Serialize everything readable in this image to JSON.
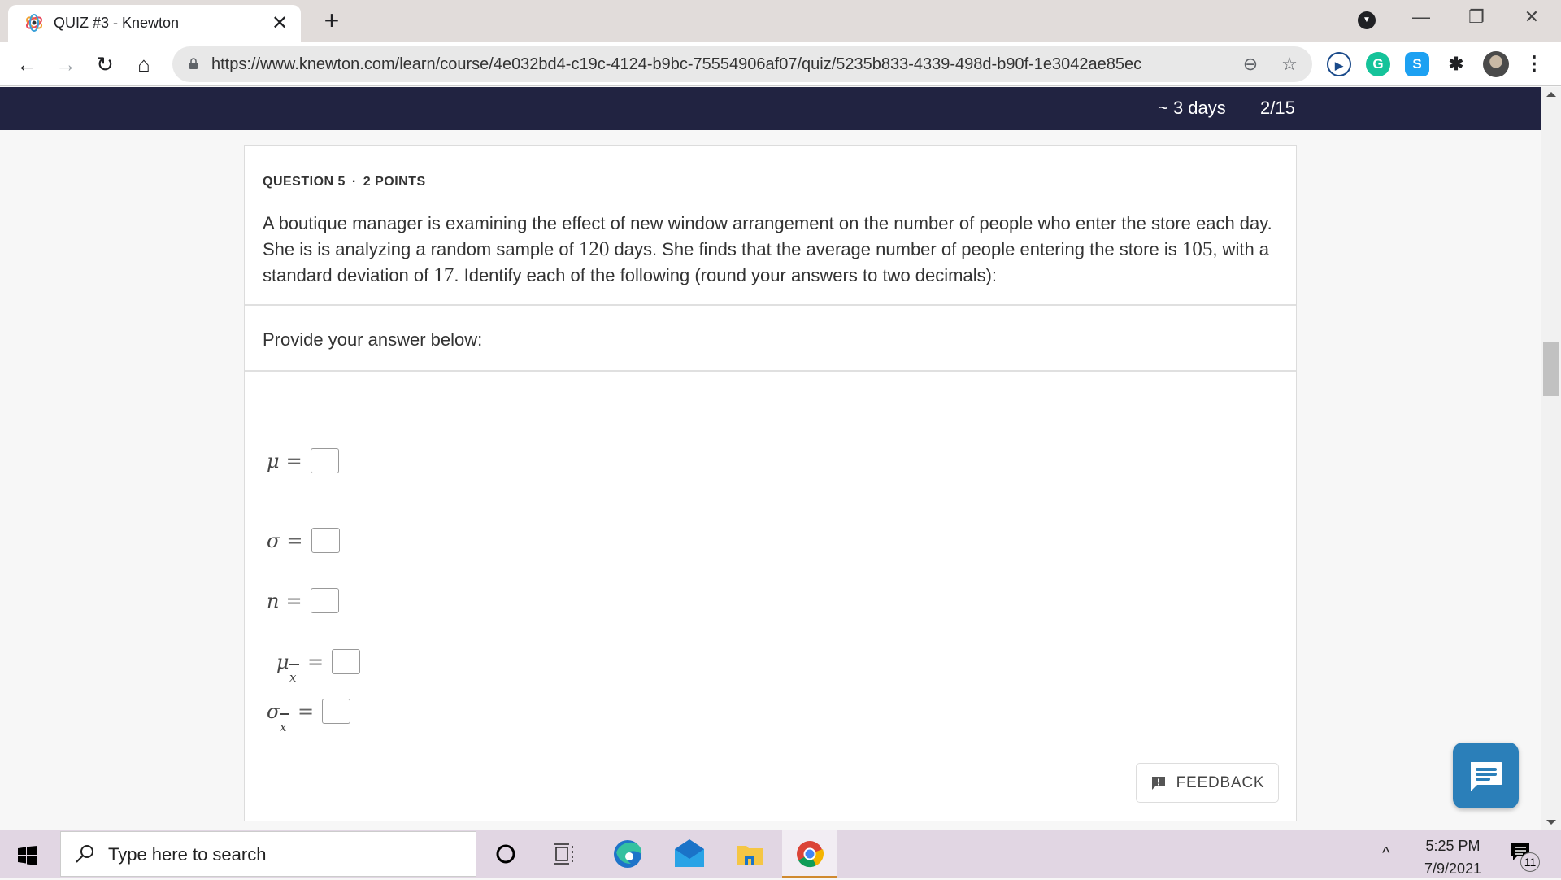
{
  "browser": {
    "tab_title": "QUIZ #3 - Knewton",
    "url": "https://www.knewton.com/learn/course/4e032bd4-c19c-4124-b9bc-75554906af07/quiz/5235b833-4339-498d-b90f-1e3042ae85ec",
    "close_tab_glyph": "✕",
    "new_tab_glyph": "+",
    "window_controls": {
      "minimize": "—",
      "restore": "❐",
      "close": "✕"
    },
    "nav": {
      "back": "←",
      "forward": "→",
      "reload": "↻",
      "home": "⌂"
    },
    "omnibox_icons": {
      "zoom": "⊖",
      "bookmark": "☆"
    },
    "extensions": [
      {
        "name": "media-play",
        "glyph": "▶",
        "color": "#1a4a8a"
      },
      {
        "name": "grammarly",
        "glyph": "G",
        "color": "#15c39a"
      },
      {
        "name": "skype",
        "glyph": "S",
        "color": "#1da1f2"
      },
      {
        "name": "extensions-puzzle",
        "glyph": "✱",
        "color": "#202124"
      }
    ],
    "menu_glyph": "⋮"
  },
  "header": {
    "time_remaining": "~ 3 days",
    "progress": "2/15"
  },
  "question": {
    "label": "QUESTION 5",
    "separator": "·",
    "points": "2 POINTS",
    "text_parts": [
      "A boutique manager is examining the effect of new window arrangement on the number of people who enter the store each day. She is is analyzing a random sample of ",
      "120",
      " days. She finds that the average number of people entering the store is ",
      "105",
      ", with a standard deviation of ",
      "17",
      ". Identify each of the following (round your answers to two decimals):"
    ],
    "prompt": "Provide your answer below:",
    "answers": [
      {
        "symbol": "μ",
        "subscript": "",
        "equals": "=",
        "value": ""
      },
      {
        "symbol": "σ",
        "subscript": "",
        "equals": "=",
        "value": ""
      },
      {
        "symbol": "n",
        "subscript": "",
        "equals": "=",
        "value": ""
      },
      {
        "symbol": "μ",
        "subscript": "x",
        "equals": "=",
        "value": ""
      },
      {
        "symbol": "σ",
        "subscript": "x",
        "equals": "=",
        "value": ""
      }
    ],
    "feedback_label": "FEEDBACK"
  },
  "colors": {
    "header_bg": "#212341",
    "chat_fab": "#2b7fb9",
    "taskbar_bg": "#e1d6e3"
  },
  "taskbar": {
    "search_placeholder": "Type here to search",
    "time": "5:25 PM",
    "date": "7/9/2021",
    "notification_count": "11",
    "tray_chevron": "^"
  }
}
